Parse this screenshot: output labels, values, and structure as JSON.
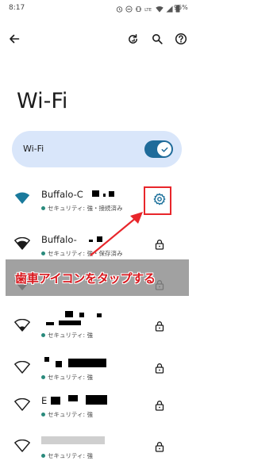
{
  "status_bar": {
    "time": "8:17",
    "battery": "95%",
    "icons": [
      "alarm-icon",
      "dnd-icon",
      "vibrate-icon",
      "lte-icon",
      "wifi-icon",
      "signal-icon",
      "battery-icon"
    ]
  },
  "toolbar": {
    "icons": [
      "back-arrow-icon",
      "refresh-icon",
      "search-icon",
      "help-icon"
    ]
  },
  "page": {
    "title": "Wi-Fi"
  },
  "wifi_toggle": {
    "label": "Wi-Fi",
    "on": true
  },
  "networks": [
    {
      "name": "Buffalo-C",
      "detail": "セキュリティ: 強・接続済み",
      "connected": true,
      "action": "settings-gear-icon"
    },
    {
      "name": "Buffalo-",
      "detail": "セキュリティ: 強・保存済み",
      "connected": false,
      "action": "lock-icon"
    },
    {
      "name": "",
      "detail": "",
      "connected": false,
      "action": "lock-icon"
    },
    {
      "name": "",
      "detail": "セキュリティ: 強",
      "connected": false,
      "action": "lock-icon"
    },
    {
      "name": "",
      "detail": "セキュリティ: 強",
      "connected": false,
      "action": "lock-icon"
    },
    {
      "name": "E",
      "detail": "セキュリティ: 強",
      "connected": false,
      "action": "lock-icon"
    },
    {
      "name": "",
      "detail": "セキュリティ: 強",
      "connected": false,
      "action": "lock-icon"
    }
  ],
  "annotation": {
    "banner_text": "歯車アイコンをタップする",
    "highlight_color": "#e8262b"
  },
  "colors": {
    "accent": "#1f6b9a",
    "card_bg": "#d9e6fa",
    "connected_icon": "#1a7a9c"
  }
}
